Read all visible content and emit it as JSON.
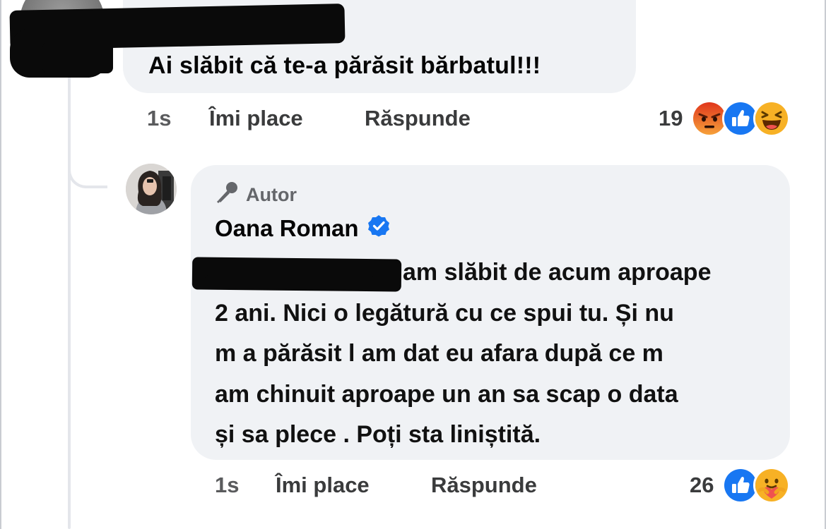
{
  "first_comment": {
    "author_redacted": "",
    "text": "Ai slăbit că te-a părăsit bărbatul!!!",
    "time": "1s",
    "like_label": "Îmi place",
    "reply_label": "Răspunde",
    "reaction_count": "19",
    "reactions": [
      "angry-reaction-icon",
      "like-reaction-icon",
      "haha-reaction-icon"
    ]
  },
  "reply": {
    "badge_label": "Autor",
    "author_name": "Oana Roman",
    "verified": true,
    "text_lines": [
      "am slăbit de acum aproape",
      "2 ani. Nici o legătură cu ce spui tu. Și nu",
      "m a părăsit l am dat eu afara după ce m",
      "am chinuit aproape un an sa scap o data",
      "și sa plece . Poți sta liniștită."
    ],
    "time": "1s",
    "like_label": "Îmi place",
    "reply_label": "Răspunde",
    "reaction_count": "26",
    "reactions": [
      "like-reaction-icon",
      "care-reaction-icon"
    ]
  },
  "colors": {
    "bubble": "#f0f2f5",
    "text": "#050505",
    "secondary_text": "#65676b",
    "like_blue": "#1877f2",
    "angry_orange": "#e9710f",
    "haha_yellow": "#f7b125"
  }
}
